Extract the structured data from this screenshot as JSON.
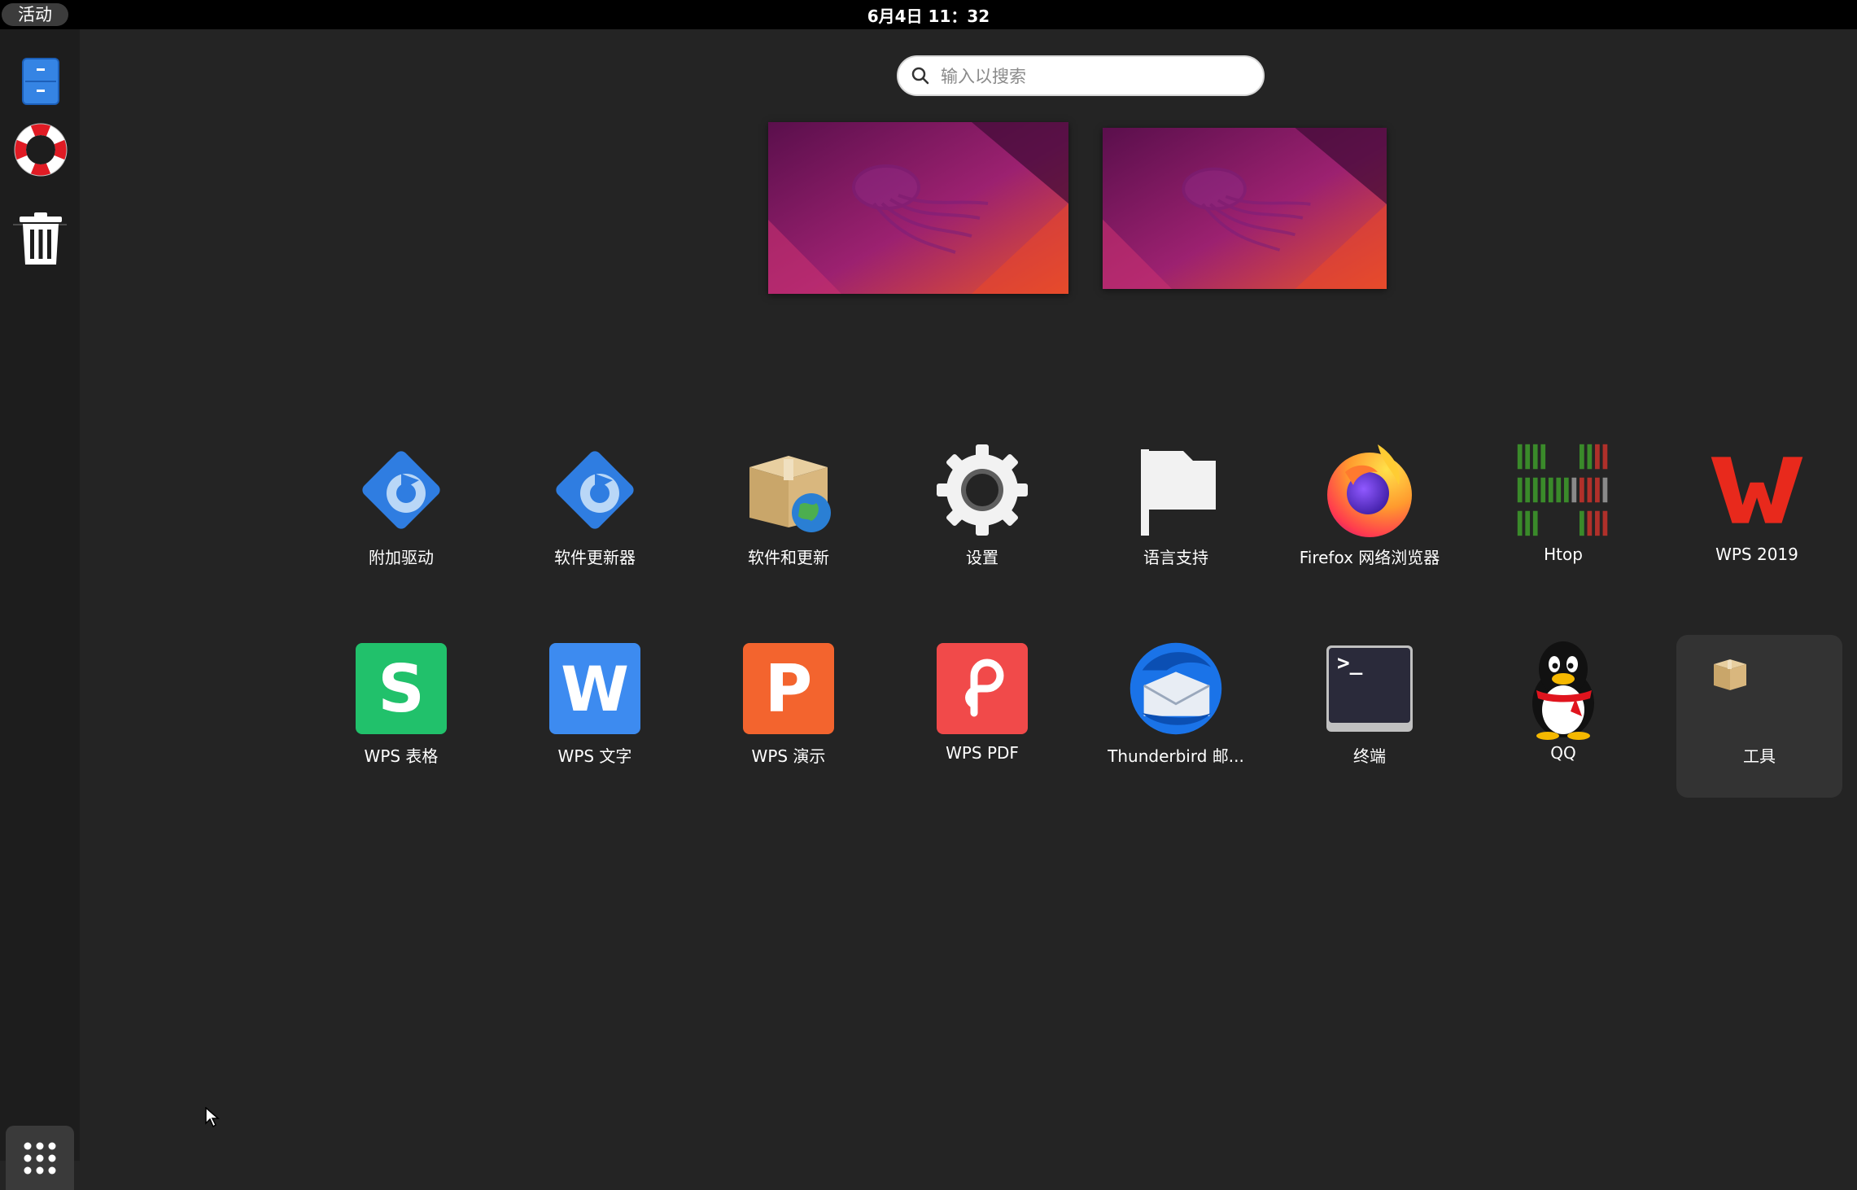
{
  "topbar": {
    "activities_label": "活动",
    "clock": "6月4日  11：32"
  },
  "dock": {
    "items": [
      {
        "name": "文件",
        "icon": "file-cabinet-icon"
      },
      {
        "name": "帮助",
        "icon": "lifebuoy-icon"
      },
      {
        "name": "回收站",
        "icon": "trash-icon"
      }
    ],
    "show_apps_icon": "grid-dots-icon"
  },
  "search": {
    "placeholder": "输入以搜索",
    "value": ""
  },
  "workspaces": {
    "count": 2
  },
  "apps": {
    "row1": [
      {
        "label": "附加驱动",
        "icon": "driver-gear-icon"
      },
      {
        "label": "软件更新器",
        "icon": "software-updater-icon"
      },
      {
        "label": "软件和更新",
        "icon": "software-box-globe-icon"
      },
      {
        "label": "设置",
        "icon": "settings-gear-icon"
      },
      {
        "label": "语言支持",
        "icon": "flag-icon"
      },
      {
        "label": "Firefox 网络浏览器",
        "icon": "firefox-icon"
      },
      {
        "label": "Htop",
        "icon": "htop-icon"
      },
      {
        "label": "WPS 2019",
        "icon": "wps-logo-icon"
      }
    ],
    "row2": [
      {
        "label": "WPS 表格",
        "icon": "wps-spreadsheet-icon",
        "letter": "S"
      },
      {
        "label": "WPS 文字",
        "icon": "wps-writer-icon",
        "letter": "W"
      },
      {
        "label": "WPS 演示",
        "icon": "wps-presentation-icon",
        "letter": "P"
      },
      {
        "label": "WPS PDF",
        "icon": "wps-pdf-icon"
      },
      {
        "label": "Thunderbird 邮...",
        "icon": "thunderbird-icon"
      },
      {
        "label": "终端",
        "icon": "terminal-icon",
        "prompt": ">_"
      },
      {
        "label": "QQ",
        "icon": "qq-penguin-icon"
      },
      {
        "label": "工具",
        "icon": "folder-package-icon"
      }
    ]
  },
  "colors": {
    "background": "#242424",
    "dock": "#1d1d1d",
    "topbar": "#000000",
    "wps_sheet": "#21c16b",
    "wps_writer": "#3d8bf0",
    "wps_present": "#f3642e",
    "wps_pdf": "#f14a4a"
  }
}
